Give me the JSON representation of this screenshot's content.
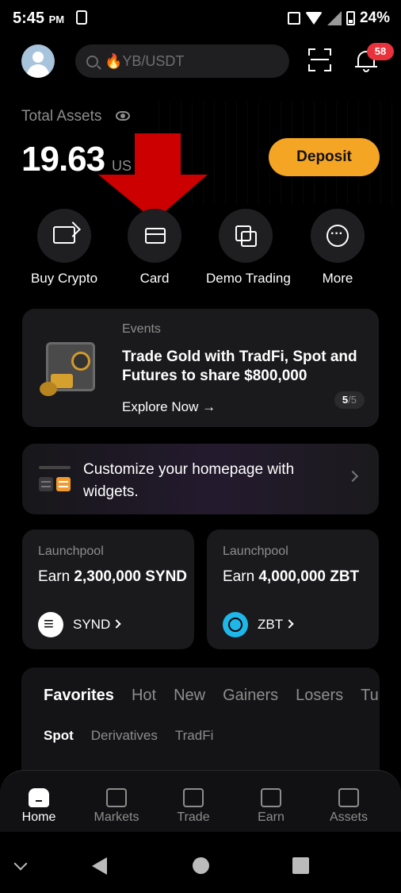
{
  "status_bar": {
    "time": "5:45",
    "ampm": "PM",
    "battery": "24%"
  },
  "header": {
    "search_placeholder": "🔥YB/USDT",
    "notification_count": "58"
  },
  "assets": {
    "label": "Total Assets",
    "balance": "19.63",
    "currency": "US",
    "deposit_label": "Deposit"
  },
  "quick_actions": [
    {
      "label": "Buy Crypto",
      "icon": "buy-crypto-icon"
    },
    {
      "label": "Card",
      "icon": "card-icon"
    },
    {
      "label": "Demo Trading",
      "icon": "demo-trading-icon"
    },
    {
      "label": "More",
      "icon": "more-icon"
    }
  ],
  "events": {
    "tag": "Events",
    "title": "Trade Gold with TradFi, Spot and Futures to share $800,000",
    "cta": "Explore Now →",
    "pager_current": "5",
    "pager_total": "/5"
  },
  "widgets_banner": {
    "text": "Customize your homepage with widgets."
  },
  "launchpools": [
    {
      "tag": "Launchpool",
      "earn_prefix": "Earn",
      "amount": "2,300,000 SYND",
      "coin": "SYND"
    },
    {
      "tag": "Launchpool",
      "earn_prefix": "Earn",
      "amount": "4,000,000 ZBT",
      "coin": "ZBT"
    }
  ],
  "favorites": {
    "tabs": [
      "Favorites",
      "Hot",
      "New",
      "Gainers",
      "Losers",
      "Turn"
    ],
    "subtabs": [
      "Spot",
      "Derivatives",
      "TradFi"
    ]
  },
  "bottom_nav": [
    {
      "label": "Home",
      "active": true
    },
    {
      "label": "Markets",
      "active": false
    },
    {
      "label": "Trade",
      "active": false
    },
    {
      "label": "Earn",
      "active": false
    },
    {
      "label": "Assets",
      "active": false
    }
  ],
  "colors": {
    "accent": "#f5a524",
    "badge": "#e8323c",
    "annotation_arrow": "#cc0000"
  }
}
